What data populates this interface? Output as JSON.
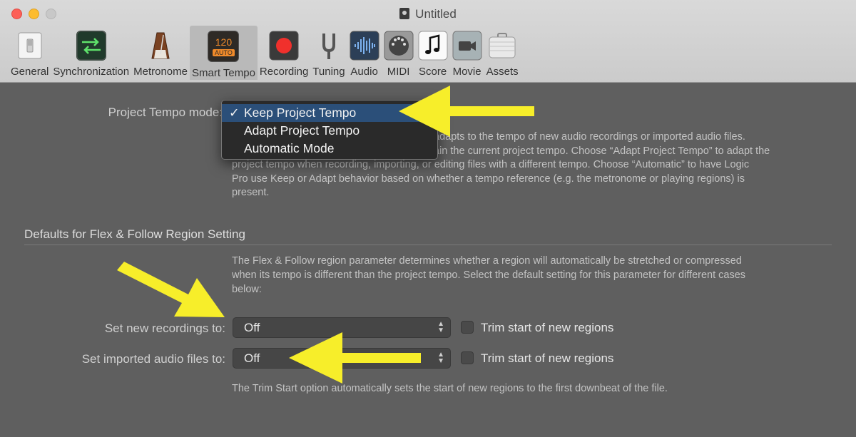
{
  "window": {
    "title": "Untitled"
  },
  "toolbar": {
    "items": [
      {
        "label": "General",
        "icon": "switch-icon"
      },
      {
        "label": "Synchronization",
        "icon": "sync-arrows-icon"
      },
      {
        "label": "Metronome",
        "icon": "metronome-icon"
      },
      {
        "label": "Smart Tempo",
        "icon": "smart-tempo-icon",
        "icon_text_top": "120",
        "icon_text_bottom": "AUTO",
        "active": true
      },
      {
        "label": "Recording",
        "icon": "record-icon"
      },
      {
        "label": "Tuning",
        "icon": "tuning-fork-icon"
      },
      {
        "label": "Audio",
        "icon": "waveform-icon"
      },
      {
        "label": "MIDI",
        "icon": "midi-port-icon"
      },
      {
        "label": "Score",
        "icon": "music-note-icon"
      },
      {
        "label": "Movie",
        "icon": "video-camera-icon"
      },
      {
        "label": "Assets",
        "icon": "briefcase-icon"
      }
    ]
  },
  "project_tempo": {
    "label": "Project Tempo mode:",
    "description_line1": "adapts to the tempo of new audio recordings or imported audio files.",
    "description_line2": "ain the current project tempo. Choose “Adapt Project Tempo” to adapt the",
    "description_line3": "project tempo when recording, importing, or editing files with a different tempo. Choose “Automatic” to have Logic",
    "description_line4": "Pro use Keep or Adapt behavior based on whether a tempo reference (e.g. the metronome or playing regions) is",
    "description_line5": "present.",
    "menu": {
      "check_mark": "✓",
      "options": [
        "Keep Project Tempo",
        "Adapt Project Tempo",
        "Automatic Mode"
      ],
      "selected_index": 0
    }
  },
  "flex_follow": {
    "section_title": "Defaults for Flex & Follow Region Setting",
    "description_line1": "The Flex & Follow region parameter determines whether a region will automatically be stretched or compressed",
    "description_line2": "when its tempo is different than the project tempo. Select the default setting for this parameter for different cases",
    "description_line3": "below:",
    "new_recordings": {
      "label": "Set new recordings to:",
      "value": "Off",
      "trim_label": "Trim start of new regions",
      "trim_checked": false
    },
    "imported_audio": {
      "label": "Set imported audio files to:",
      "value": "Off",
      "trim_label": "Trim start of new regions",
      "trim_checked": false
    },
    "footnote": "The Trim Start option automatically sets the start of new regions to the first downbeat of the file."
  },
  "colors": {
    "annotation_arrow": "#f7ee2a",
    "menu_highlight": "#2b4f79",
    "window_background": "#5f5f5f"
  }
}
